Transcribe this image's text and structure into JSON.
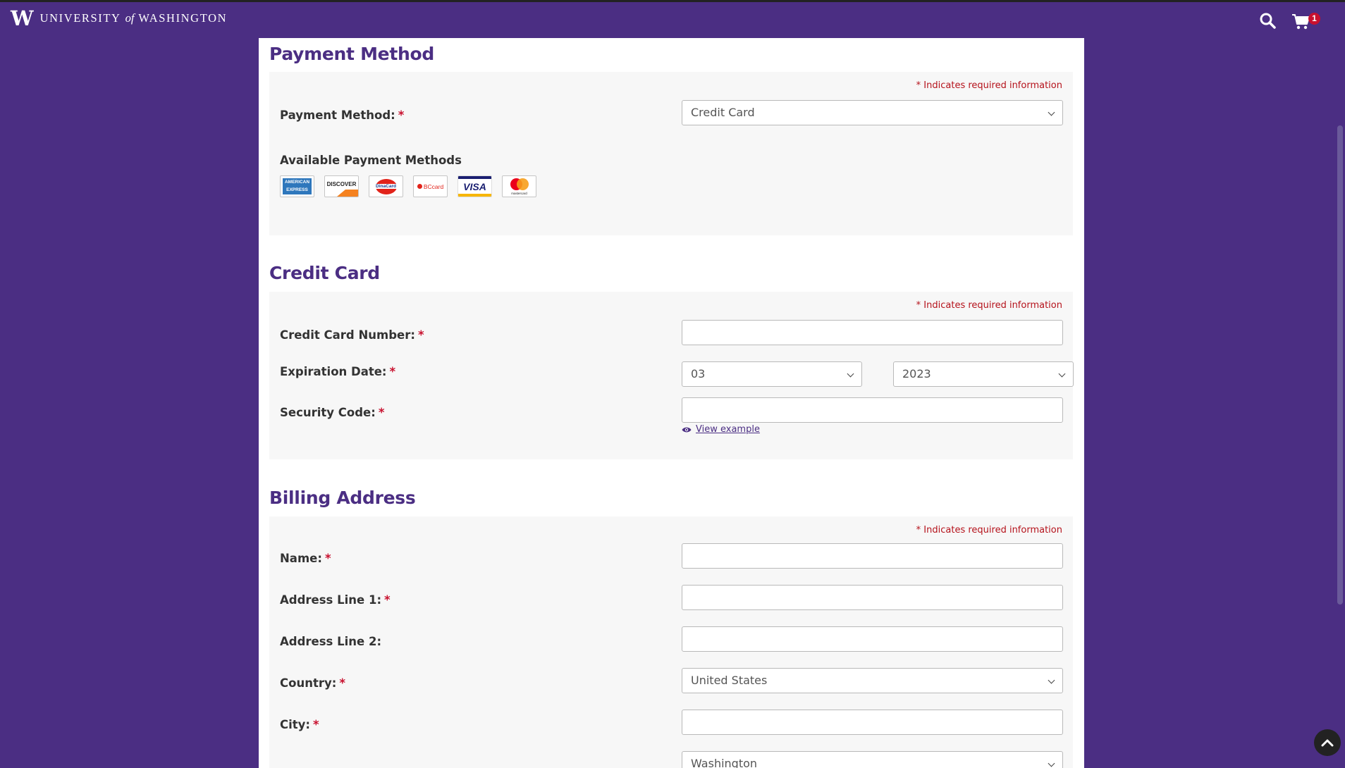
{
  "header": {
    "brand_w": "W",
    "brand_university": "UNIVERSITY",
    "brand_of": "of",
    "brand_washington": "WASHINGTON",
    "cart_count": "1"
  },
  "required_note": "* Indicates required information",
  "payment_method": {
    "title": "Payment Method",
    "label": "Payment Method:",
    "selected": "Credit Card",
    "available_heading": "Available Payment Methods",
    "cards": [
      {
        "name": "American Express",
        "text": "AMERICAN EXPRESS",
        "color": "#2e77bc"
      },
      {
        "name": "Discover",
        "text": "DISCOVER",
        "color": "#f58220"
      },
      {
        "name": "DinaCard",
        "text": "DinaCard",
        "color": "#e2231a"
      },
      {
        "name": "BCcard",
        "text": "BCcard",
        "color": "#e2231a"
      },
      {
        "name": "Visa",
        "text": "VISA",
        "color": "#1a1f71"
      },
      {
        "name": "Mastercard",
        "text": "mastercard",
        "color": "#eb001b"
      }
    ]
  },
  "credit_card": {
    "title": "Credit Card",
    "number_label": "Credit Card Number:",
    "number_value": "",
    "expiration_label": "Expiration Date:",
    "exp_month": "03",
    "exp_year": "2023",
    "security_label": "Security Code:",
    "security_value": "",
    "view_example": "View example"
  },
  "billing": {
    "title": "Billing Address",
    "name_label": "Name:",
    "address1_label": "Address Line 1:",
    "address2_label": "Address Line 2:",
    "country_label": "Country:",
    "country_value": "United States",
    "city_label": "City:",
    "state_value": "Washington"
  },
  "colors": {
    "brand_purple": "#4b2e83",
    "required_red": "#c8102e"
  }
}
